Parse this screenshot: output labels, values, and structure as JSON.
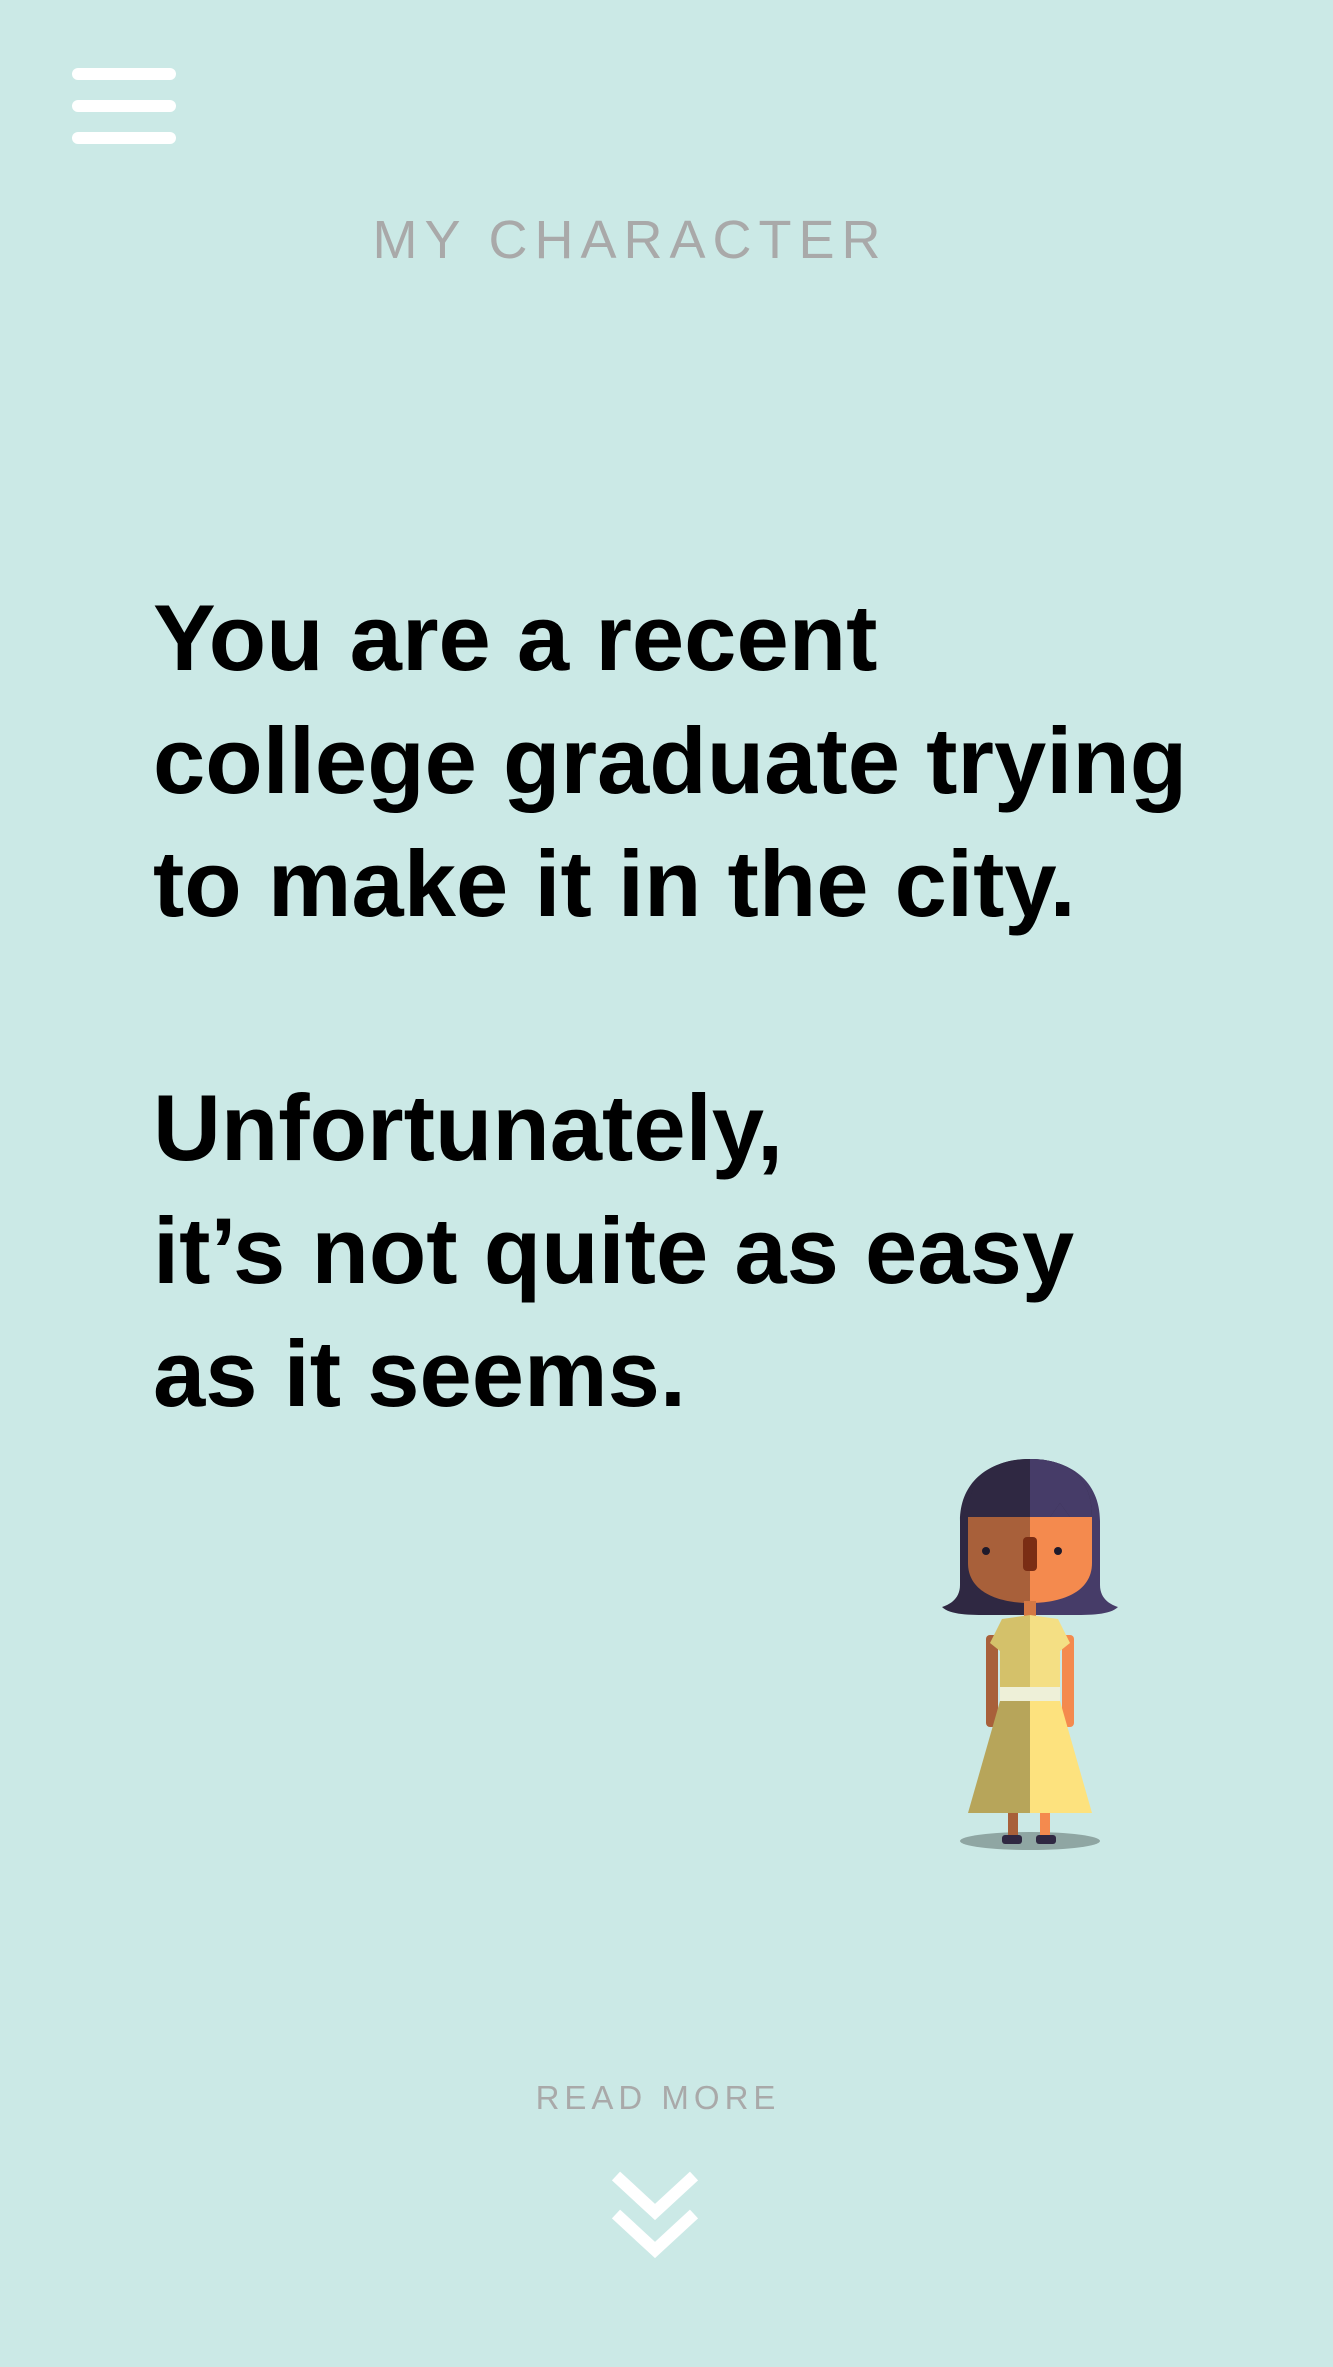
{
  "header": {
    "menu_icon": "hamburger-menu-icon",
    "title": "MY CHARACTER"
  },
  "story": {
    "intro_lines": [
      "You are a recent",
      "college graduate trying",
      "to make it in the city."
    ],
    "twist_lines": [
      "Unfortunately,",
      "it’s not quite as easy",
      "as it seems."
    ]
  },
  "character": {
    "icon": "character-girl-yellow-dress-illustration"
  },
  "footer": {
    "read_more_label": "READ MORE",
    "scroll_icon": "double-chevron-down-icon"
  },
  "colors": {
    "background": "#cbe9e6",
    "heading_gray": "#a9a9a9",
    "text": "#000000",
    "icon_white": "#ffffff"
  }
}
